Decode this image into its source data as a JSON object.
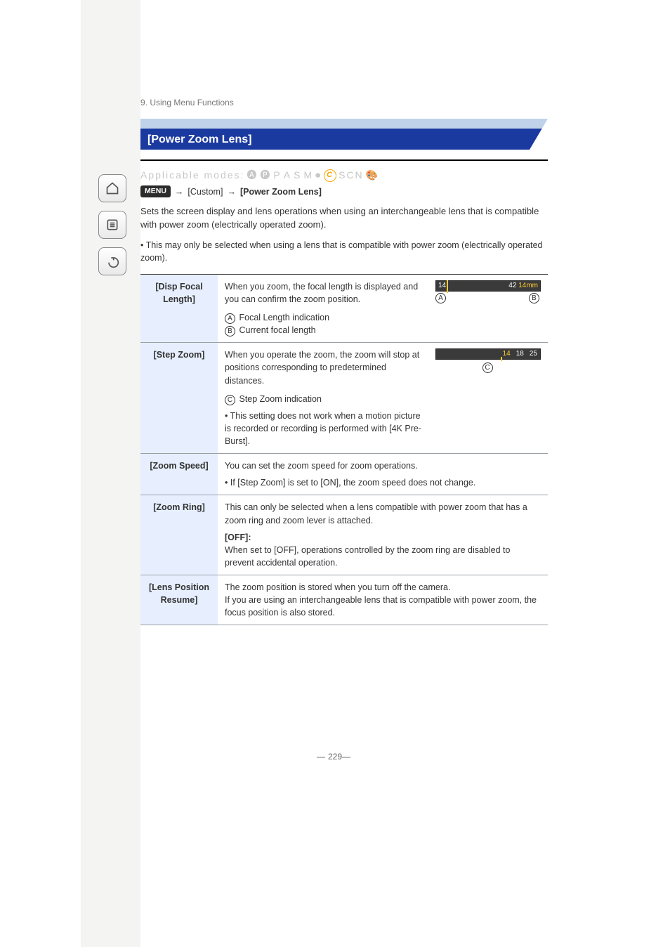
{
  "breadcrumb": "9. Using Menu Functions",
  "title": "[Power Zoom Lens]",
  "modes": {
    "applicable": [
      "iA",
      "P",
      "A",
      "S",
      "M",
      "Movie",
      "C",
      "Scene",
      "Creative"
    ],
    "custom_icon_alt": "custom-mode"
  },
  "menu_path": {
    "menu": "MENU",
    "arrow": "→",
    "custom": "[Custom]",
    "target": "[Power Zoom Lens]"
  },
  "intro": "Sets the screen display and lens operations when using an interchangeable lens that is compatible with power zoom (electrically operated zoom).",
  "intro_note_bullet": "• This may only be selected when using a lens that is compatible with power zoom (electrically operated zoom).",
  "table": {
    "rows": [
      {
        "label": "[Disp Focal Length]",
        "desc": "When you zoom, the focal length is displayed and you can confirm the zoom position.",
        "legend": [
          {
            "mark": "A",
            "text": "Focal Length indication"
          },
          {
            "mark": "B",
            "text": "Current focal length"
          }
        ],
        "bar": {
          "min": "14",
          "max": "42",
          "current": "14",
          "unit": "mm",
          "marker_pos_pct": 10
        }
      },
      {
        "label": "[Step Zoom]",
        "desc": "When you operate the zoom, the zoom will stop at positions corresponding to predetermined distances.",
        "legend": [
          {
            "mark": "C",
            "text": "Step Zoom indication"
          }
        ],
        "note_bullet": "• This setting does not work when a motion picture is recorded or recording is performed with [4K Pre-Burst].",
        "stepbar": {
          "values": [
            "14",
            "18",
            "25"
          ],
          "current": "14",
          "tick_pos_pct": 62
        }
      },
      {
        "label": "[Zoom Speed]",
        "desc": "You can set the zoom speed for zoom operations.",
        "note_bullet": "• If [Step Zoom] is set to [ON], the zoom speed does not change."
      },
      {
        "label": "[Zoom Ring]",
        "desc_top": "This can only be selected when a lens compatible with power zoom that has a zoom ring and zoom lever is attached.",
        "desc_off": "When set to [OFF], operations controlled by the zoom ring are disabled to prevent accidental operation.",
        "label_off": "[OFF]:"
      },
      {
        "label": "[Lens Position Resume]",
        "desc": "The zoom position is stored when you turn off the camera.",
        "desc_extra": "If you are using an interchangeable lens that is compatible with power zoom, the focus position is also stored."
      }
    ]
  },
  "page_number": "229",
  "side_buttons": {
    "home": "home-icon",
    "toc": "list-icon",
    "back": "back-icon"
  }
}
